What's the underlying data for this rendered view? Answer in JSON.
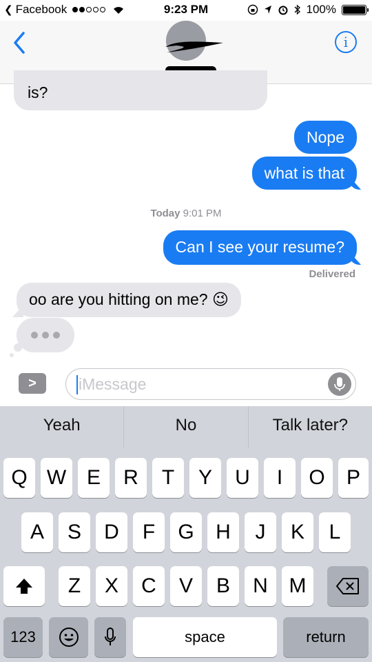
{
  "status_bar": {
    "back_app": "Facebook",
    "time": "9:23 PM",
    "battery": "100%"
  },
  "header": {
    "info_glyph": "i"
  },
  "messages": [
    {
      "dir": "in",
      "text": "is?"
    },
    {
      "dir": "out",
      "text": "Nope"
    },
    {
      "dir": "out",
      "text": "what is that"
    },
    {
      "dir": "out",
      "text": "Can I see your resume?"
    },
    {
      "dir": "in",
      "text": "oo are you hitting on me? 😉"
    }
  ],
  "timestamp": {
    "day": "Today",
    "time": "9:01 PM"
  },
  "delivered": "Delivered",
  "input": {
    "placeholder": "iMessage",
    "apps_glyph": ">"
  },
  "predictive": [
    "Yeah",
    "No",
    "Talk later?"
  ],
  "keyboard": {
    "row1": [
      "Q",
      "W",
      "E",
      "R",
      "T",
      "Y",
      "U",
      "I",
      "O",
      "P"
    ],
    "row2": [
      "A",
      "S",
      "D",
      "F",
      "G",
      "H",
      "J",
      "K",
      "L"
    ],
    "row3": [
      "Z",
      "X",
      "C",
      "V",
      "B",
      "N",
      "M"
    ],
    "numbers_key": "123",
    "space_key": "space",
    "return_key": "return"
  },
  "colors": {
    "outgoing_bubble": "#1a7cf2",
    "incoming_bubble": "#e5e5ea",
    "keyboard_bg": "#d1d4da"
  }
}
